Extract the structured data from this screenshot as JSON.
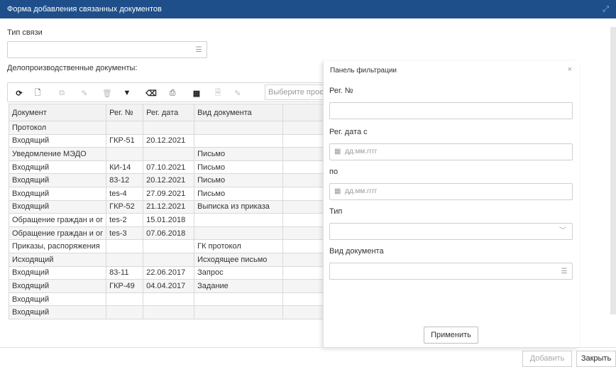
{
  "window": {
    "title": "Форма добавления связанных документов"
  },
  "link_type": {
    "label": "Тип связи",
    "value": ""
  },
  "documents": {
    "label": "Делопроизводственные документы:",
    "search_placeholder": "Выберите проє",
    "columns": [
      "Документ",
      "Рег. №",
      "Рег. дата",
      "Вид документа"
    ],
    "rows": [
      [
        "Протокол",
        "",
        "",
        ""
      ],
      [
        "Входящий",
        "ГКР-51",
        "20.12.2021",
        ""
      ],
      [
        "Уведомление МЭДО",
        "",
        "",
        "Письмо"
      ],
      [
        "Входящий",
        "КИ-14",
        "07.10.2021",
        "Письмо"
      ],
      [
        "Входящий",
        "83-12",
        "20.12.2021",
        "Письмо"
      ],
      [
        "Входящий",
        "tes-4",
        "27.09.2021",
        "Письмо"
      ],
      [
        "Входящий",
        "ГКР-52",
        "21.12.2021",
        "Выписка из приказа"
      ],
      [
        "Обращение граждан и ог",
        "tes-2",
        "15.01.2018",
        ""
      ],
      [
        "Обращение граждан и ог",
        "tes-3",
        "07.06.2018",
        ""
      ],
      [
        "Приказы, распоряжения",
        "",
        "",
        "ГК протокол"
      ],
      [
        "Исходящий",
        "",
        "",
        "Исходящее письмо"
      ],
      [
        "Входящий",
        "83-11",
        "22.06.2017",
        "Запрос"
      ],
      [
        "Входящий",
        "ГКР-49",
        "04.04.2017",
        "Задание"
      ],
      [
        "Входящий",
        "",
        "",
        ""
      ],
      [
        "Входящий",
        "",
        "",
        ""
      ]
    ]
  },
  "filter": {
    "title": "Панель фильтрации",
    "close": "×",
    "reg_no_label": "Рег. №",
    "reg_date_from_label": "Рег. дата с",
    "date_placeholder": "дд.мм.гггг",
    "to_label": "по",
    "type_label": "Тип",
    "doc_kind_label": "Вид документа",
    "apply": "Применить"
  },
  "footer": {
    "add": "Добавить",
    "close": "Закрыть"
  }
}
